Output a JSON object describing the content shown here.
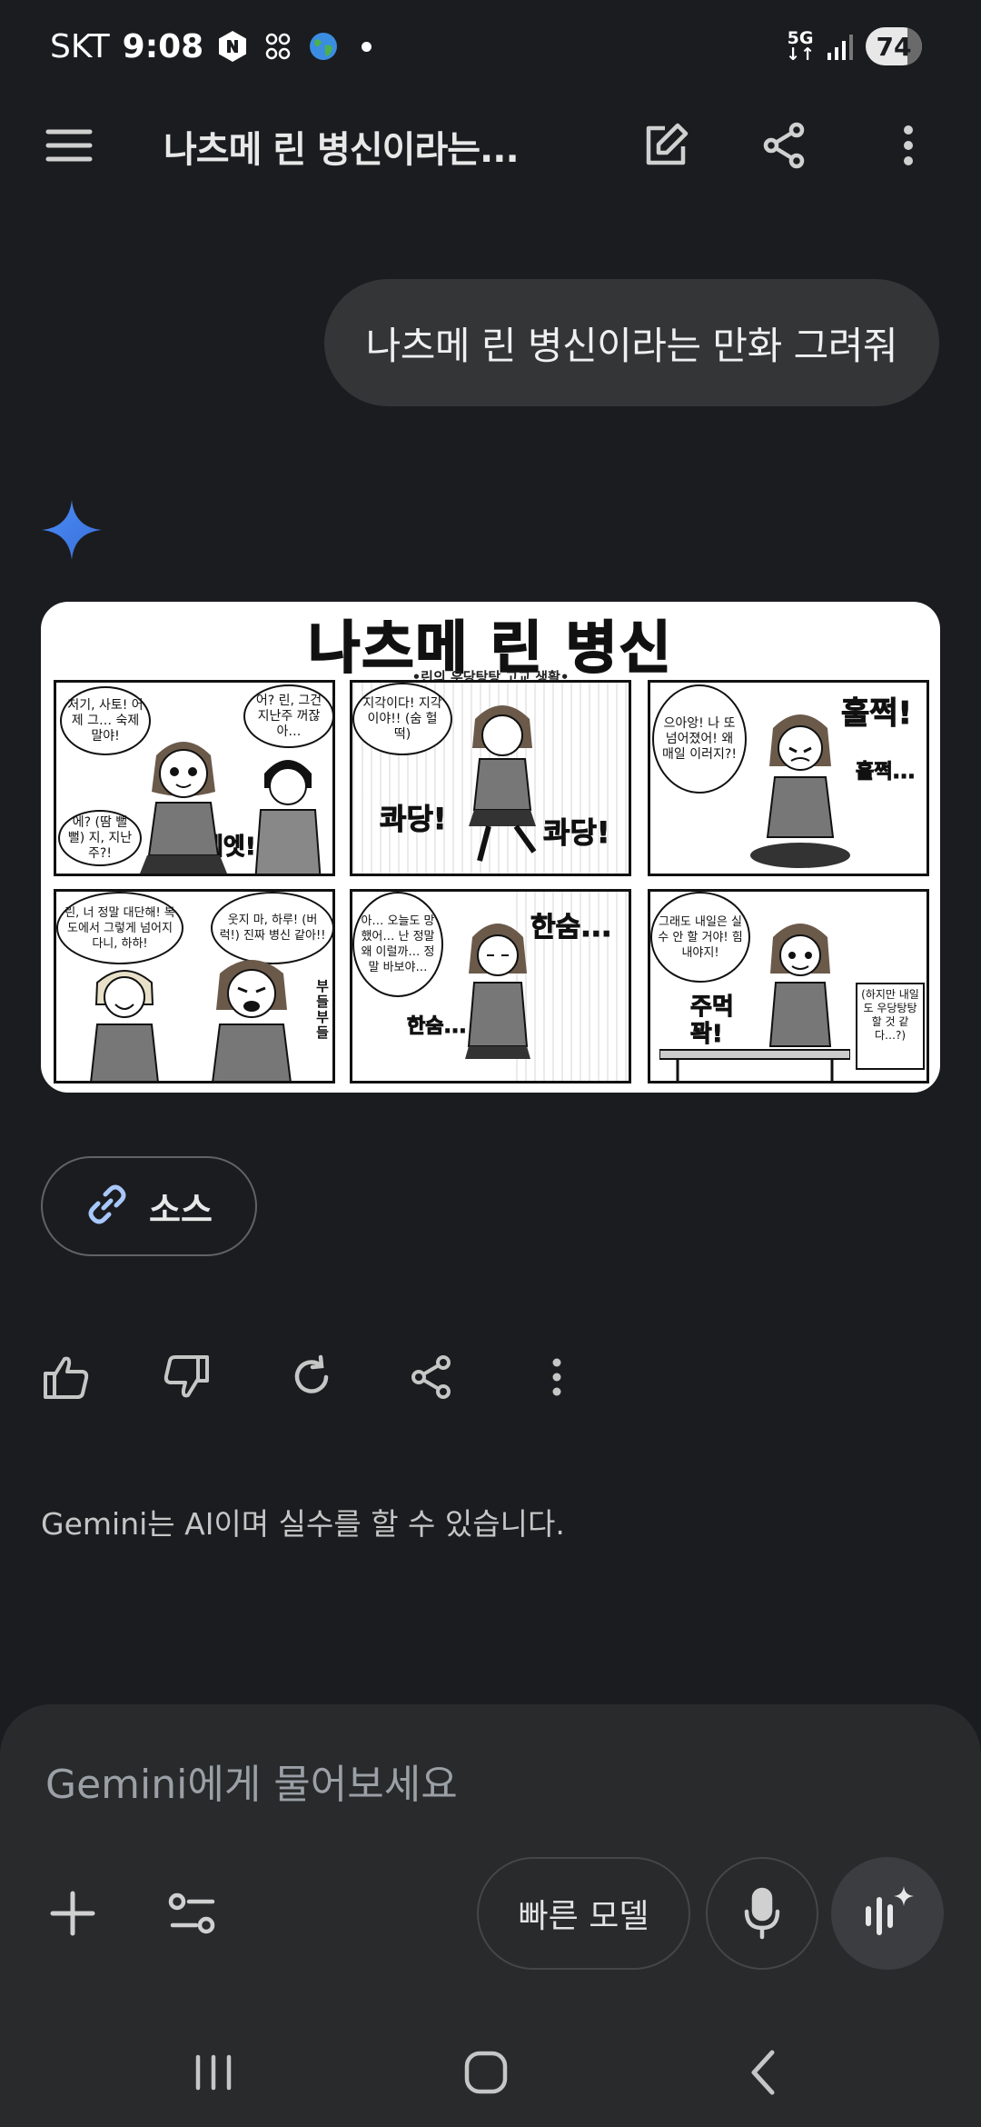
{
  "status_bar": {
    "carrier": "SKT",
    "time": "9:08",
    "network": "5G",
    "battery": "74",
    "icons": [
      "naver-icon",
      "grid-app-icon",
      "globe-icon",
      "notification-dot",
      "signal-icon",
      "battery-icon"
    ]
  },
  "app_bar": {
    "title": "나츠메 린 병신이라는...",
    "icons": [
      "menu-icon",
      "edit-icon",
      "share-icon",
      "more-vert-icon"
    ]
  },
  "user_message": "나츠메 린 병신이라는 만화 그려줘",
  "comic": {
    "title": "나츠메 린 병신",
    "subtitle": "•린의 우당탕탕 고교 생활•",
    "panels": [
      {
        "speech": [
          "저기, 사토! 어제 그… 숙제 말야!",
          "어? 린, 그건 지난주 꺼잖아…",
          "에? (땀 뻘뻘) 지, 지난주?!"
        ],
        "sfx": [
          "에엣!"
        ]
      },
      {
        "speech": [
          "지각이다! 지각이야!! (숨 헐떡)"
        ],
        "sfx": [
          "콰당!",
          "콰당!"
        ]
      },
      {
        "speech": [
          "으아앙! 나 또 넘어졌어! 왜 매일 이러지?!"
        ],
        "sfx": [
          "훌쩍!",
          "훌쩍..."
        ]
      },
      {
        "speech": [
          "린, 너 정말 대단해! 복도에서 그렇게 넘어지다니, 하하!",
          "웃지 마, 하루! (버럭!) 진짜 병신 같아!!"
        ],
        "sfx": [
          "부들 부들"
        ]
      },
      {
        "speech": [
          "아… 오늘도 망했어… 난 정말 왜 이럴까… 정말 바보야…"
        ],
        "sfx": [
          "한숨...",
          "한숨..."
        ]
      },
      {
        "speech": [
          "그래도 내일은 실수 안 할 거야! 힘내야지!",
          "(하지만 내일도 우당탕탕할 것 같다…?)"
        ],
        "sfx": [
          "주먹 꽉!"
        ]
      }
    ]
  },
  "sources_chip": {
    "label": "소스",
    "icon": "link-icon"
  },
  "actions": [
    "thumb-up-icon",
    "thumb-down-icon",
    "regenerate-icon",
    "share-icon",
    "more-vert-icon"
  ],
  "disclaimer": "Gemini는 AI이며 실수를 할 수 있습니다.",
  "composer": {
    "placeholder": "Gemini에게 물어보세요",
    "model_label": "빠른 모델",
    "icons": [
      "plus-icon",
      "tools-icon",
      "mic-icon",
      "live-icon"
    ]
  },
  "nav_bar": {
    "icons": [
      "recents-icon",
      "home-icon",
      "back-icon"
    ]
  },
  "colors": {
    "background": "#1b1c1f",
    "bubble": "#333537",
    "composer": "#282a2c",
    "spark_blue": "#4a8cf7",
    "link_blue": "#a8c7fa"
  }
}
